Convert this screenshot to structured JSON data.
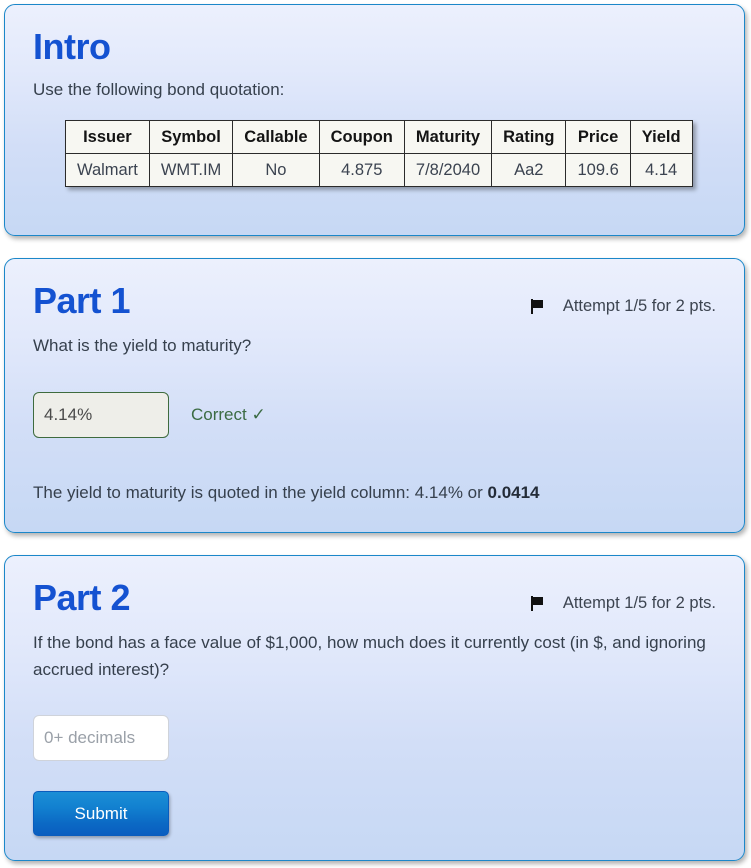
{
  "intro": {
    "title": "Intro",
    "prompt": "Use the following bond quotation:",
    "table": {
      "headers": [
        "Issuer",
        "Symbol",
        "Callable",
        "Coupon",
        "Maturity",
        "Rating",
        "Price",
        "Yield"
      ],
      "rows": [
        [
          "Walmart",
          "WMT.IM",
          "No",
          "4.875",
          "7/8/2040",
          "Aa2",
          "109.6",
          "4.14"
        ]
      ]
    }
  },
  "part1": {
    "title": "Part 1",
    "flag_icon": "flag-icon",
    "attempt": "Attempt 1/5 for 2 pts.",
    "question": "What is the yield to maturity?",
    "answer_value": "4.14%",
    "answer_placeholder": "",
    "verdict": "Correct ✓",
    "explanation_prefix": "The yield to maturity is quoted in the yield column: 4.14% or ",
    "explanation_bold": "0.0414"
  },
  "part2": {
    "title": "Part 2",
    "flag_icon": "flag-icon",
    "attempt": "Attempt 1/5 for 2 pts.",
    "question": "If the bond has a face value of $1,000, how much does it currently cost (in $, and ignoring accrued interest)?",
    "answer_value": "",
    "answer_placeholder": "0+ decimals",
    "submit_label": "Submit"
  },
  "colors": {
    "heading_blue": "#1452d1",
    "card_border": "#1b87c9",
    "correct_green": "#3b6b43",
    "submit_blue": "#0b68c4",
    "body_text": "#36404d"
  }
}
